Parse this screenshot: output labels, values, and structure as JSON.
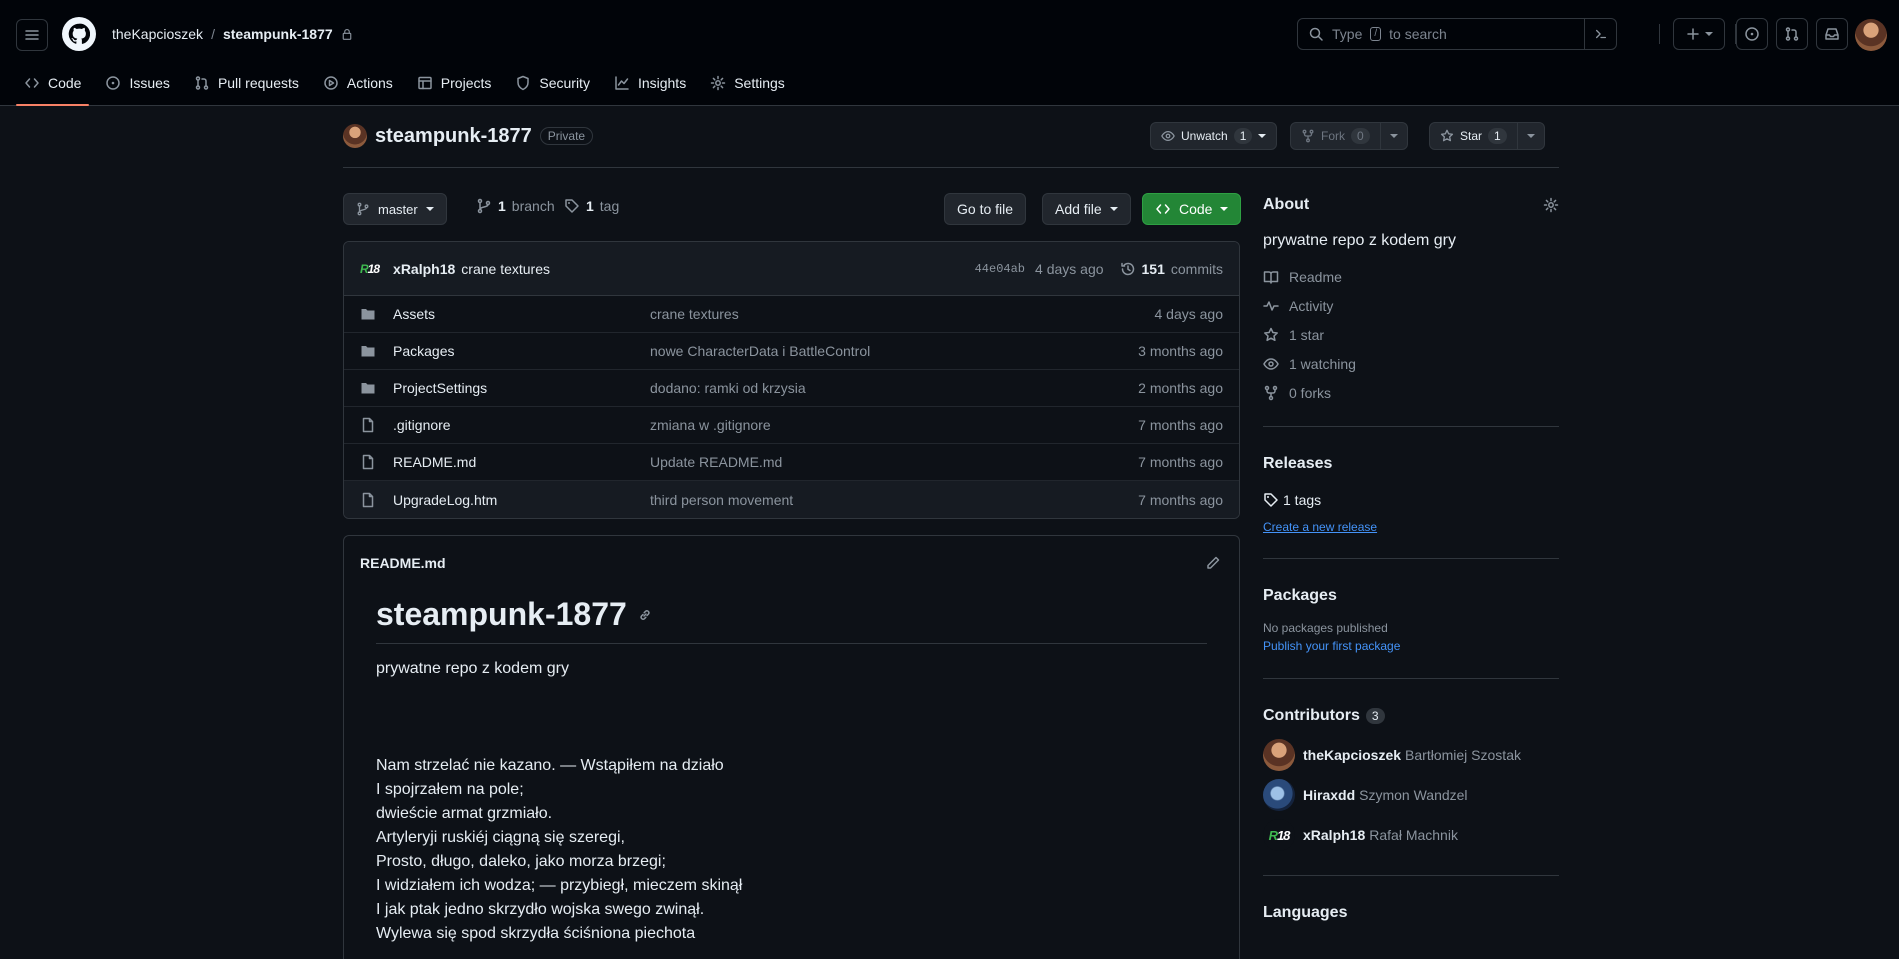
{
  "header": {
    "owner": "theKapcioszek",
    "separator": "/",
    "repo": "steampunk-1877",
    "search_placeholder_pre": "Type",
    "search_slash": "/",
    "search_placeholder_post": "to search"
  },
  "tabs": [
    {
      "label": "Code",
      "icon": "code-icon"
    },
    {
      "label": "Issues",
      "icon": "issue-icon"
    },
    {
      "label": "Pull requests",
      "icon": "pull-request-icon"
    },
    {
      "label": "Actions",
      "icon": "play-icon"
    },
    {
      "label": "Projects",
      "icon": "table-icon"
    },
    {
      "label": "Security",
      "icon": "shield-icon"
    },
    {
      "label": "Insights",
      "icon": "graph-icon"
    },
    {
      "label": "Settings",
      "icon": "gear-icon"
    }
  ],
  "repo_header": {
    "name": "steampunk-1877",
    "visibility": "Private",
    "unwatch_label": "Unwatch",
    "unwatch_count": "1",
    "fork_label": "Fork",
    "fork_count": "0",
    "star_label": "Star",
    "star_count": "1"
  },
  "branchbar": {
    "branch": "master",
    "branch_count": "1",
    "branch_word": "branch",
    "tag_count": "1",
    "tag_word": "tag",
    "go_to_file": "Go to file",
    "add_file": "Add file",
    "code": "Code"
  },
  "last_commit": {
    "author_badge_left": "R",
    "author_badge_right": "18",
    "author": "xRalph18",
    "message": "crane textures",
    "sha": "44e04ab",
    "age": "4 days ago",
    "commits_count": "151",
    "commits_word": "commits"
  },
  "files": [
    {
      "type": "folder",
      "name": "Assets",
      "message": "crane textures",
      "age": "4 days ago"
    },
    {
      "type": "folder",
      "name": "Packages",
      "message": "nowe CharacterData i BattleControl",
      "age": "3 months ago"
    },
    {
      "type": "folder",
      "name": "ProjectSettings",
      "message": "dodano: ramki od krzysia",
      "age": "2 months ago"
    },
    {
      "type": "file",
      "name": ".gitignore",
      "message": "zmiana w .gitignore",
      "age": "7 months ago"
    },
    {
      "type": "file",
      "name": "README.md",
      "message": "Update README.md",
      "age": "7 months ago"
    },
    {
      "type": "file",
      "name": "UpgradeLog.htm",
      "message": "third person movement",
      "age": "7 months ago"
    }
  ],
  "readme": {
    "filename": "README.md",
    "heading": "steampunk-1877",
    "description": "prywatne repo z kodem gry",
    "poem": [
      "Nam strzelać nie kazano. — Wstąpiłem na działo",
      "I spojrzałem na pole;",
      "dwieście armat grzmiało.",
      "Artyleryji ruskiéj ciągną się szeregi,",
      "Prosto, długo, daleko, jako morza brzegi;",
      "I widziałem ich wodza; — przybiegł, mieczem skinął",
      "I jak ptak jedno skrzydło wojska swego zwinął.",
      "Wylewa się spod skrzydła ściśniona piechota"
    ]
  },
  "sidebar": {
    "about_title": "About",
    "about_desc": "prywatne repo z kodem gry",
    "about_items": [
      {
        "icon": "book-icon",
        "label": "Readme"
      },
      {
        "icon": "pulse-icon",
        "label": "Activity"
      },
      {
        "icon": "star-icon",
        "label": "1 star"
      },
      {
        "icon": "eye-icon",
        "label": "1 watching"
      },
      {
        "icon": "fork-icon",
        "label": "0 forks"
      }
    ],
    "releases_title": "Releases",
    "releases_tags": "1 tags",
    "create_release": "Create a new release",
    "packages_title": "Packages",
    "packages_none": "No packages published",
    "packages_publish": "Publish your first package",
    "contributors_title": "Contributors",
    "contributors_count": "3",
    "contributors": [
      {
        "login": "theKapcioszek",
        "name": "Bartłomiej Szostak"
      },
      {
        "login": "Hiraxdd",
        "name": "Szymon Wandzel"
      },
      {
        "login": "xRalph18",
        "name": "Rafał Machnik"
      }
    ],
    "languages_title": "Languages"
  },
  "colors": {
    "accent_tab": "#f78166",
    "code_button": "#238636",
    "link": "#4493f8"
  }
}
